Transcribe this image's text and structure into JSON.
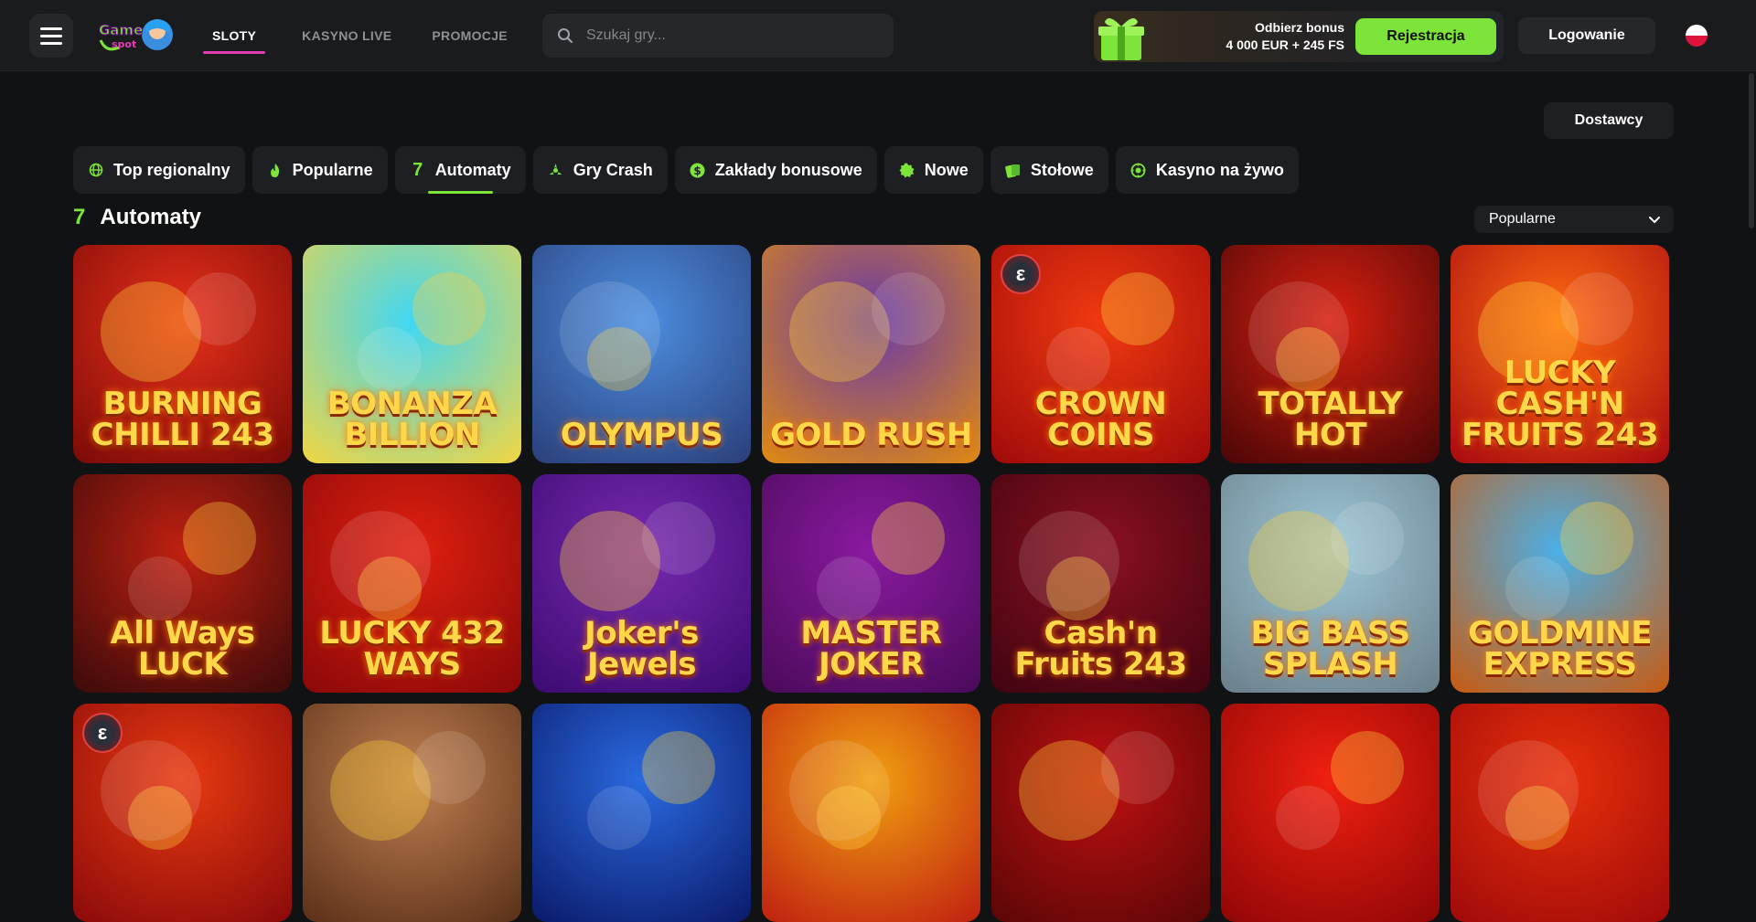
{
  "header": {
    "nav": [
      "SLOTY",
      "KASYNO LIVE",
      "PROMOCJE"
    ],
    "search_placeholder": "Szukaj gry...",
    "bonus_line1": "Odbierz bonus",
    "bonus_line2": "4 000 EUR + 245 FS",
    "register_label": "Rejestracja",
    "login_label": "Logowanie",
    "logo_text": "GameSpot"
  },
  "providers_label": "Dostawcy",
  "categories": [
    {
      "label": "Top regionalny",
      "icon": "globe-icon"
    },
    {
      "label": "Popularne",
      "icon": "flame-icon"
    },
    {
      "label": "Automaty",
      "icon": "seven-icon"
    },
    {
      "label": "Gry Crash",
      "icon": "crash-icon"
    },
    {
      "label": "Zakłady bonusowe",
      "icon": "dollar-icon"
    },
    {
      "label": "Nowe",
      "icon": "new-icon"
    },
    {
      "label": "Stołowe",
      "icon": "cards-icon"
    },
    {
      "label": "Kasyno na żywo",
      "icon": "live-icon"
    }
  ],
  "section": {
    "title": "Automaty",
    "title_icon": "7"
  },
  "sort": {
    "selected": "Popularne"
  },
  "games": [
    {
      "title": "BURNING CHILLI 243",
      "bg1": "#e8301a",
      "bg2": "#7a0a06"
    },
    {
      "title": "BONANZA BILLION",
      "bg1": "#3fd7f5",
      "bg2": "#f3d640"
    },
    {
      "title": "OLYMPUS",
      "bg1": "#4d8fe0",
      "bg2": "#2a3f7a"
    },
    {
      "title": "GOLD RUSH",
      "bg1": "#6a3aa8",
      "bg2": "#e08a10"
    },
    {
      "title": "CROWN COINS",
      "bg1": "#f03a10",
      "bg2": "#a00a0a"
    },
    {
      "title": "TOTALLY HOT",
      "bg1": "#d82010",
      "bg2": "#4a0606"
    },
    {
      "title": "LUCKY CASH'N FRUITS 243",
      "bg1": "#ff6a10",
      "bg2": "#a80a10"
    },
    {
      "title": "All Ways LUCK",
      "bg1": "#c02010",
      "bg2": "#3a0a0a"
    },
    {
      "title": "LUCKY 432 WAYS",
      "bg1": "#e02010",
      "bg2": "#8a0808"
    },
    {
      "title": "Joker's Jewels",
      "bg1": "#7a2ab0",
      "bg2": "#3a0a70"
    },
    {
      "title": "MASTER JOKER",
      "bg1": "#8a1aa0",
      "bg2": "#4a0a5a"
    },
    {
      "title": "Cash'n Fruits 243",
      "bg1": "#8a1020",
      "bg2": "#400410"
    },
    {
      "title": "BIG BASS SPLASH",
      "bg1": "#9ec8d8",
      "bg2": "#6a7f8a"
    },
    {
      "title": "GOLDMINE EXPRESS",
      "bg1": "#4ab0e8",
      "bg2": "#c85a10"
    },
    {
      "title": "",
      "bg1": "#e83a10",
      "bg2": "#8a0a0a"
    },
    {
      "title": "",
      "bg1": "#c08050",
      "bg2": "#5a3018"
    },
    {
      "title": "",
      "bg1": "#2a6ae0",
      "bg2": "#0a1a6a"
    },
    {
      "title": "",
      "bg1": "#f0a010",
      "bg2": "#c02010"
    },
    {
      "title": "",
      "bg1": "#c01010",
      "bg2": "#5a0606"
    },
    {
      "title": "",
      "bg1": "#f02010",
      "bg2": "#900606"
    },
    {
      "title": "",
      "bg1": "#e8300a",
      "bg2": "#a00a0a"
    }
  ]
}
